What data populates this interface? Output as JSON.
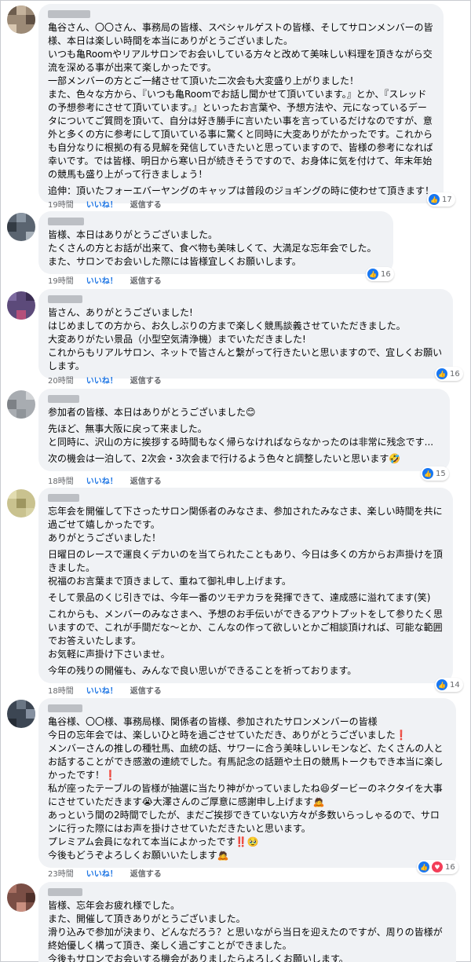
{
  "reactions_icons": {
    "like": "thumbs-up-icon",
    "love": "heart-icon"
  },
  "labels": {
    "like": "いいね！",
    "reply": "返信する"
  },
  "comments": [
    {
      "lines": [
        "亀谷さん、〇〇さん、事務局の皆様、スペシャルゲストの皆様、そしてサロンメンバーの皆様、本日は楽しい時間を本当にありがとうございました。",
        "いつも亀Roomやリアルサロンでお会いしている方々と改めて美味しい料理を頂きながら交流を深める事が出来て楽しかったです。",
        "一部メンバーの方とご一緒させて頂いた二次会も大変盛り上がりました！",
        "また、色々な方から、『いつも亀Roomでお話し聞かせて頂いています。』とか、『スレッドの予想参考にさせて頂いています。』といったお言葉や、予想方法や、元になっているデータについてご質問を頂いて、自分は好き勝手に言いたい事を言っているだけなのですが、意外と多くの方に参考にして頂いている事に驚くと同時に大変ありがたかったです。これからも自分なりに根拠の有る見解を発信していきたいと思っていますので、皆様の参考になれば幸いです。では皆様、明日から寒い日が続きそうですので、お身体に気を付けて、年末年始の競馬も盛り上がって行きましょう！",
        "追伸：頂いたフォーエバーヤングのキャップは普段のジョギングの時に使わせて頂きます！"
      ],
      "time": "19時間",
      "reaction_count": "17"
    },
    {
      "lines": [
        "皆様、本日はありがとうございました。",
        "たくさんの方とお話が出来て、食べ物も美味しくて、大満足な忘年会でした。",
        "また、サロンでお会いした際には皆様宜しくお願いします。"
      ],
      "time": "19時間",
      "reaction_count": "16"
    },
    {
      "lines": [
        "皆さん、ありがとうございました!",
        "はじめましての方から、お久しぶりの方まで楽しく競馬談義させていただきました。",
        "大変ありがたい景品（小型空気清浄機）までいただきました!",
        "これからもリアルサロン、ネットで皆さんと繋がって行きたいと思いますので、宜しくお願いします。"
      ],
      "time": "20時間",
      "reaction_count": "16"
    },
    {
      "lines": [
        "参加者の皆様、本日はありがとうございました😊",
        "先ほど、無事大阪に戻って来ました。",
        "と同時に、沢山の方に挨拶する時間もなく帰らなければならなかったのは非常に残念です...",
        "次の機会は一泊して、2次会・3次会まで行けるよう色々と調整したいと思います🤣"
      ],
      "time": "18時間",
      "reaction_count": "15"
    },
    {
      "lines": [
        "忘年会を開催して下さったサロン関係者のみなさま、参加されたみなさま、楽しい時間を共に過ごせて嬉しかったです。",
        "ありがとうございました！",
        "日曜日のレースで運良くデカいのを当てられたこともあり、今日は多くの方からお声掛けを頂きました。",
        "祝福のお言葉まで頂きまして、重ねて御礼申し上げます。",
        "そして景品のくじ引きでは、今年一番のツモヂカラを発揮できて、達成感に溢れてます(笑)",
        "これからも、メンバーのみなさまへ、予想のお手伝いができるアウトプットをして参りたく思いますので、これが手間だな〜とか、こんなの作って欲しいとかご相談頂ければ、可能な範囲でお答えいたします。",
        "お気軽に声掛け下さいませ。",
        "今年の残りの開催も、みんなで良い思いができることを祈っております。"
      ],
      "time": "18時間",
      "reaction_count": "14"
    },
    {
      "lines": [
        "亀谷様、〇〇様、事務局様、関係者の皆様、参加されたサロンメンバーの皆様",
        "今日の忘年会では、楽しいひと時を過ごさせていただき、ありがとうございました❗",
        "メンバーさんの推しの種牡馬、血統の話、サワーに合う美味しいレモンなど、たくさんの人とお話することができ感激の連続でした。有馬記念の話題や土日の競馬トークもでき本当に楽しかったです！❗",
        "私が座ったテーブルの皆様が抽選に当たり神がかっていましたね😆ダービーのネクタイを大事にさせていただきます😭大澤さんのご厚意に感謝申し上げます🙇",
        "あっという間の2時間でしたが、まだご挨拶できていない方々が多数いらっしゃるので、サロンに行った際にはお声を掛けさせていただきたいと思います。",
        "プレミアム会員になれて本当によかったです‼️🥹",
        "今後もどうぞよろしくお願いいたします🙇"
      ],
      "time": "23時間",
      "reaction_count": "16"
    },
    {
      "lines": [
        "皆様、忘年会お疲れ様でした。",
        "また、開催して頂きありがとうございました。",
        "滑り込みで参加が決まり、どんなだろう？と思いながら当日を迎えたのですが、周りの皆様が終始優しく構って頂き、楽しく過ごすことができました。",
        "今後もサロンでお会いする機会がありましたらよろしくお願いします。"
      ],
      "time": "",
      "reaction_count": ""
    }
  ]
}
